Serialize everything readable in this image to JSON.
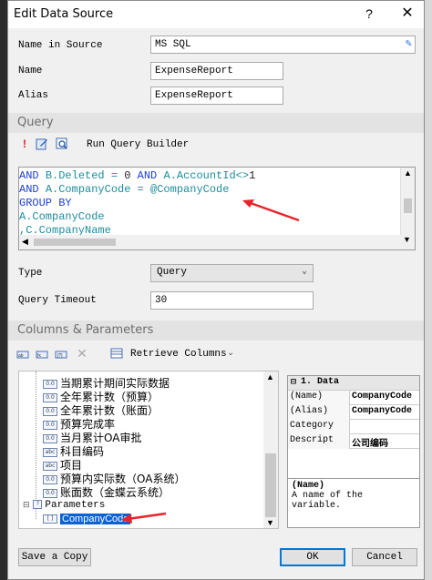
{
  "window": {
    "title": "Edit Data Source",
    "help_label": "?",
    "close_label": "✕"
  },
  "form": {
    "name_in_source_label": "Name in Source",
    "name_in_source_value": "MS SQL",
    "name_label": "Name",
    "name_value": "ExpenseReport",
    "alias_label": "Alias",
    "alias_value": "ExpenseReport"
  },
  "query_section": {
    "header": "Query",
    "run_query_builder": "Run Query Builder",
    "lines": [
      [
        {
          "t": "AND ",
          "c": "kw"
        },
        {
          "t": "B.Deleted = ",
          "c": "var"
        },
        {
          "t": "0 ",
          "c": "num"
        },
        {
          "t": "AND ",
          "c": "kw"
        },
        {
          "t": "A.AccountId<>",
          "c": "var"
        },
        {
          "t": "1",
          "c": "num"
        }
      ],
      [
        {
          "t": "AND ",
          "c": "kw"
        },
        {
          "t": "A.CompanyCode = @CompanyCode",
          "c": "var"
        }
      ],
      [
        {
          "t": "GROUP BY",
          "c": "kw"
        }
      ],
      [
        {
          "t": "A.CompanyCode",
          "c": "var"
        }
      ],
      [
        {
          "t": ",C.CompanyName",
          "c": "var"
        }
      ]
    ],
    "type_label": "Type",
    "type_value": "Query",
    "timeout_label": "Query Timeout",
    "timeout_value": "30"
  },
  "columns_section": {
    "header": "Columns & Parameters",
    "retrieve_columns": "Retrieve Columns",
    "tree_items": [
      {
        "label": "当期累计期间实际数据",
        "icon": "0.0"
      },
      {
        "label": "全年累计数（预算）",
        "icon": "0.0"
      },
      {
        "label": "全年累计数（账面）",
        "icon": "0.0"
      },
      {
        "label": "预算完成率",
        "icon": "0.0"
      },
      {
        "label": "当月累计OA审批",
        "icon": "0.0"
      },
      {
        "label": "科目编码",
        "icon": "abc"
      },
      {
        "label": "项目",
        "icon": "abc"
      },
      {
        "label": "预算内实际数（OA系统）",
        "icon": "0.0"
      },
      {
        "label": "账面数（金蝶云系统）",
        "icon": "0.0"
      }
    ],
    "parameters_label": "Parameters",
    "selected_param": "CompanyCode"
  },
  "properties": {
    "group": "1. Data",
    "rows": [
      {
        "key": "(Name)",
        "value": "CompanyCode"
      },
      {
        "key": "(Alias)",
        "value": "CompanyCode"
      },
      {
        "key": "Category",
        "value": ""
      },
      {
        "key": "Descript",
        "value": "公司编码"
      }
    ],
    "desc_title": "(Name)",
    "desc_text": "A name of the variable."
  },
  "buttons": {
    "save_copy": "Save a Copy",
    "ok": "OK",
    "cancel": "Cancel"
  },
  "colors": {
    "accent": "#0078d7",
    "selection": "#0a62d4",
    "annotation_arrow": "#e8232a"
  }
}
